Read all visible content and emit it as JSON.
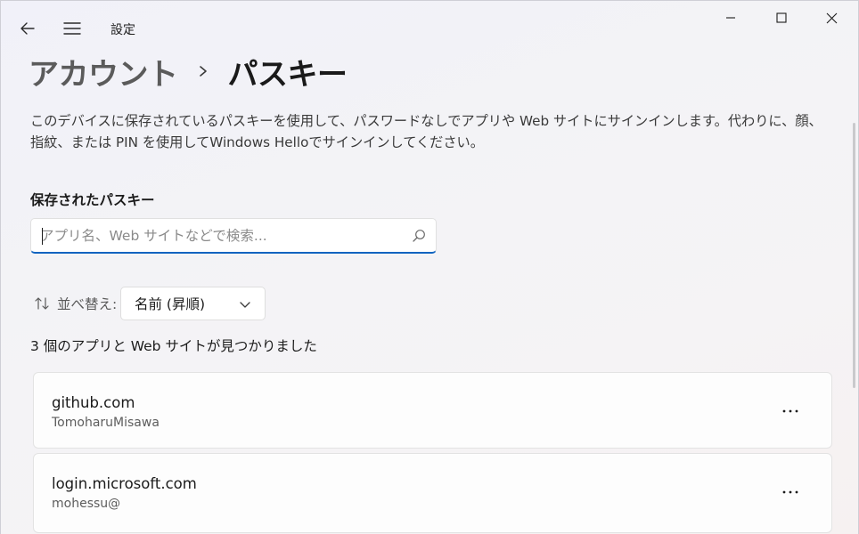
{
  "titlebar": {
    "app_title": "設定"
  },
  "breadcrumb": {
    "parent": "アカウント",
    "current": "パスキー"
  },
  "description": "このデバイスに保存されているパスキーを使用して、パスワードなしでアプリや Web サイトにサインインします。代わりに、顔、指紋、または PIN を使用してWindows Helloでサインインしてください。",
  "saved_section": {
    "title": "保存されたパスキー",
    "search_placeholder": "アプリ名、Web サイトなどで検索..."
  },
  "sort": {
    "label": "並べ替え:",
    "selected": "名前 (昇順)"
  },
  "result_count": "3 個のアプリと Web サイトが見つかりました",
  "passkeys": [
    {
      "site": "github.com",
      "user": "TomoharuMisawa",
      "more": "..."
    },
    {
      "site": "login.microsoft.com",
      "user": "mohessu@",
      "more": "..."
    }
  ],
  "icons": {
    "back": "back-arrow-icon",
    "menu": "hamburger-menu-icon",
    "minimize": "minimize-icon",
    "maximize": "maximize-icon",
    "close": "close-icon",
    "search": "search-icon",
    "sort": "sort-arrows-icon",
    "chevron": "chevron-down-icon",
    "more": "more-options-icon"
  },
  "colors": {
    "accent": "#0f64c0"
  }
}
